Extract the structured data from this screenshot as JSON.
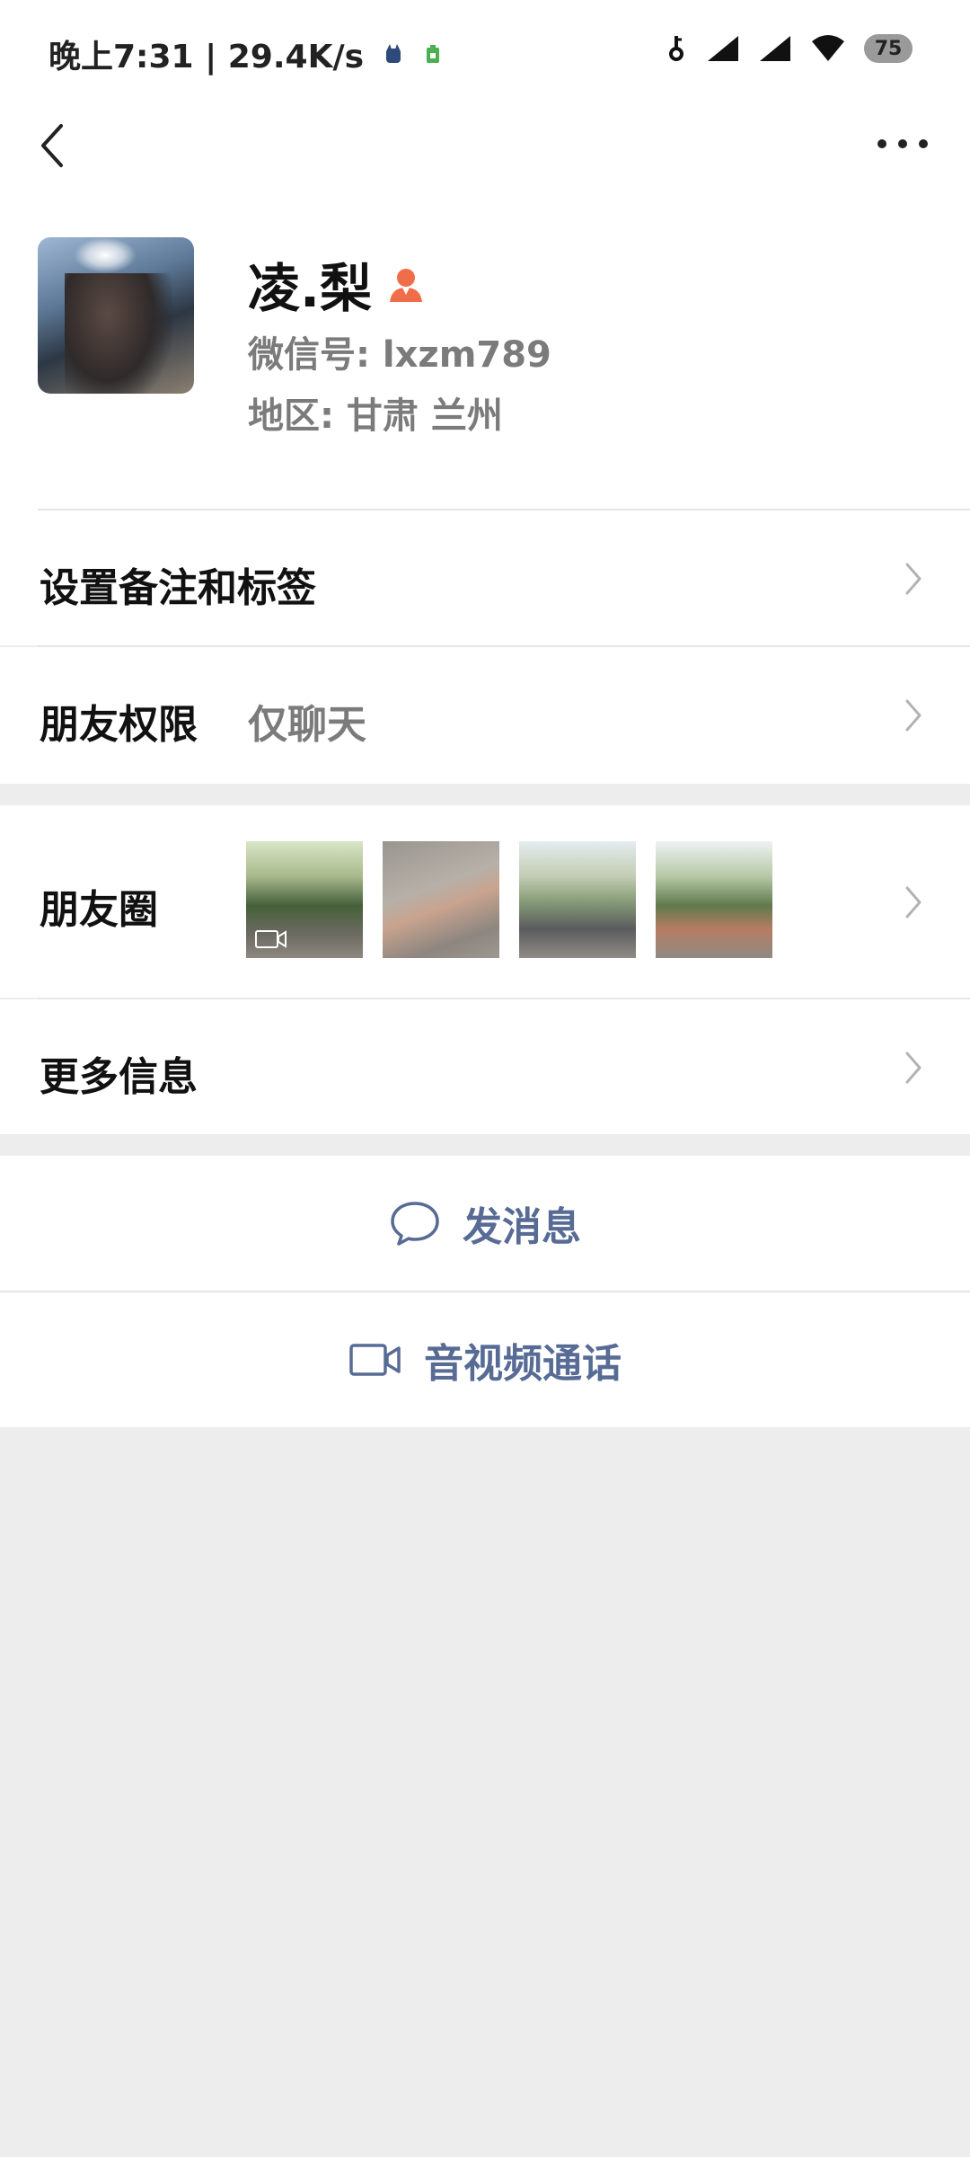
{
  "status_bar": {
    "time_speed": "晚上7:31 | 29.4K/s",
    "battery_level": "75"
  },
  "profile": {
    "name": "凌.梨",
    "wechat_id": "微信号: lxzm789",
    "region": "地区: 甘肃  兰州",
    "gender": "female"
  },
  "rows": {
    "remark_tags": {
      "label": "设置备注和标签"
    },
    "permissions": {
      "label": "朋友权限",
      "value": "仅聊天"
    },
    "moments": {
      "label": "朋友圈",
      "thumbnail_count": 4
    },
    "more_info": {
      "label": "更多信息"
    }
  },
  "actions": {
    "send_message": "发消息",
    "av_call": "音视频通话"
  },
  "colors": {
    "link_blue": "#576b95",
    "gender_female": "#f06d4a",
    "page_background": "#ededed"
  },
  "icons": {
    "back": "chevron-left-icon",
    "more": "ellipsis-icon",
    "chevron": "chevron-right-icon",
    "chat": "chat-bubble-icon",
    "video": "video-camera-icon"
  }
}
